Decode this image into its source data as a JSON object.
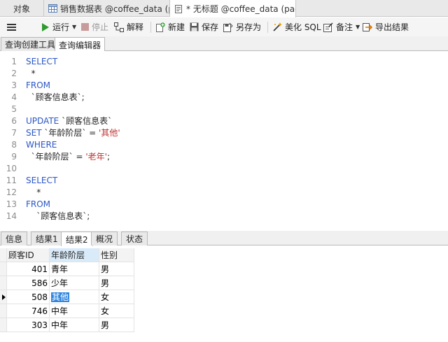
{
  "tabs": [
    {
      "label": "对象"
    },
    {
      "label": "销售数据表 @coffee_data (p..."
    },
    {
      "label": "* 无标题 @coffee_data (pac..."
    }
  ],
  "toolbar": {
    "run": "运行",
    "stop": "停止",
    "explain": "解释",
    "new": "新建",
    "save": "保存",
    "save_as": "另存为",
    "beautify": "美化 SQL",
    "comment": "备注",
    "export": "导出结果"
  },
  "subtabs": [
    "查询创建工具",
    "查询编辑器"
  ],
  "editor_lines": [
    {
      "n": "1",
      "parts": [
        {
          "t": "SELECT",
          "c": "kw"
        }
      ]
    },
    {
      "n": "2",
      "parts": [
        {
          "t": "  *",
          "c": ""
        }
      ]
    },
    {
      "n": "3",
      "parts": [
        {
          "t": "FROM",
          "c": "kw"
        }
      ]
    },
    {
      "n": "4",
      "parts": [
        {
          "t": "  `顾客信息表`;",
          "c": ""
        }
      ]
    },
    {
      "n": "5",
      "parts": []
    },
    {
      "n": "6",
      "parts": [
        {
          "t": "UPDATE",
          "c": "kw"
        },
        {
          "t": " `顾客信息表`",
          "c": ""
        }
      ]
    },
    {
      "n": "7",
      "parts": [
        {
          "t": "SET",
          "c": "kw"
        },
        {
          "t": " `年龄阶层` = ",
          "c": ""
        },
        {
          "t": "'其他'",
          "c": "str"
        }
      ]
    },
    {
      "n": "8",
      "parts": [
        {
          "t": "WHERE",
          "c": "kw"
        }
      ]
    },
    {
      "n": "9",
      "parts": [
        {
          "t": "  `年龄阶层` = ",
          "c": ""
        },
        {
          "t": "'老年'",
          "c": "str"
        },
        {
          "t": ";",
          "c": ""
        }
      ]
    },
    {
      "n": "10",
      "parts": []
    },
    {
      "n": "11",
      "parts": [
        {
          "t": "SELECT",
          "c": "kw"
        }
      ]
    },
    {
      "n": "12",
      "parts": [
        {
          "t": "    *",
          "c": ""
        }
      ]
    },
    {
      "n": "13",
      "parts": [
        {
          "t": "FROM",
          "c": "kw"
        }
      ]
    },
    {
      "n": "14",
      "parts": [
        {
          "t": "    `顾客信息表`;",
          "c": ""
        }
      ]
    }
  ],
  "result_tabs": [
    "信息",
    "结果1",
    "结果2",
    "概况",
    "状态"
  ],
  "grid": {
    "columns": [
      "顾客ID",
      "年龄阶层",
      "性别"
    ],
    "rows": [
      [
        "401",
        "青年",
        "男"
      ],
      [
        "586",
        "少年",
        "男"
      ],
      [
        "508",
        "其他",
        "女"
      ],
      [
        "746",
        "中年",
        "女"
      ],
      [
        "303",
        "中年",
        "男"
      ]
    ],
    "current_row": 2
  }
}
